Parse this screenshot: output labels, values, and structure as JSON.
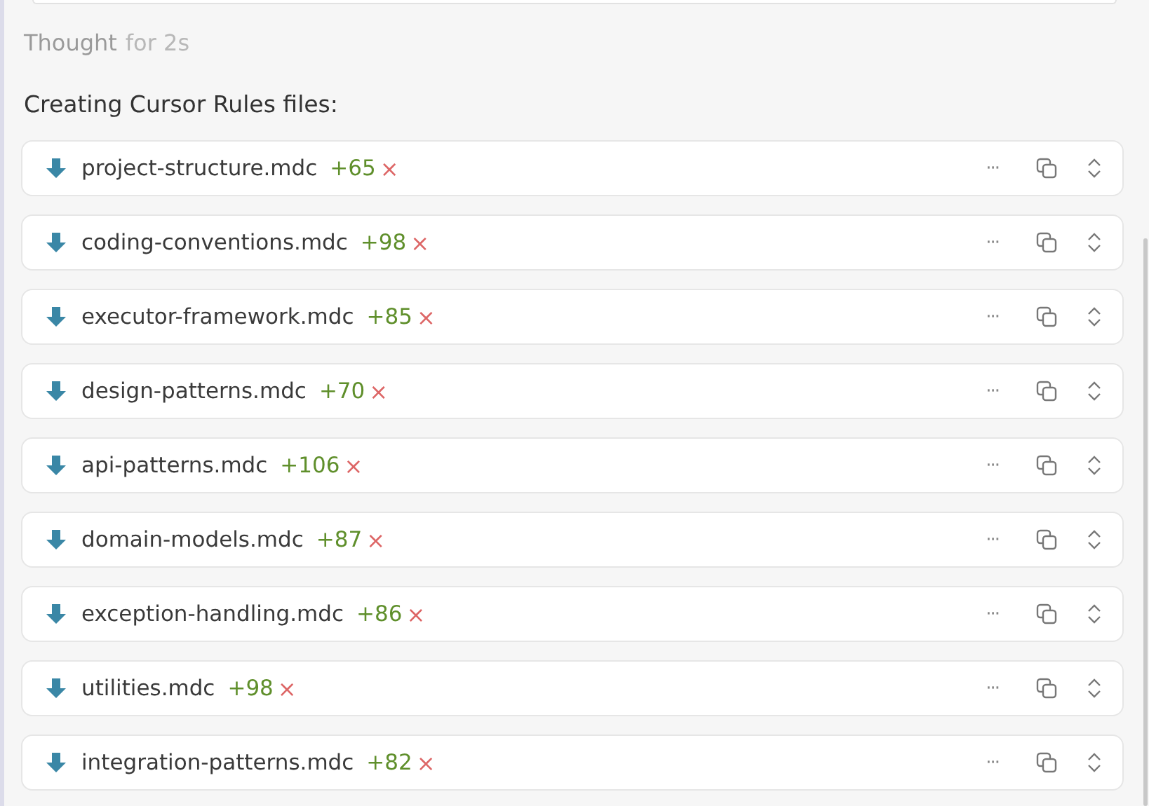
{
  "thought": {
    "label": "Thought",
    "duration": "for 2s"
  },
  "heading": "Creating Cursor Rules files:",
  "files": [
    {
      "name": "project-structure.mdc",
      "added": "+65",
      "reject": "×"
    },
    {
      "name": "coding-conventions.mdc",
      "added": "+98",
      "reject": "×"
    },
    {
      "name": "executor-framework.mdc",
      "added": "+85",
      "reject": "×"
    },
    {
      "name": "design-patterns.mdc",
      "added": "+70",
      "reject": "×"
    },
    {
      "name": "api-patterns.mdc",
      "added": "+106",
      "reject": "×"
    },
    {
      "name": "domain-models.mdc",
      "added": "+87",
      "reject": "×"
    },
    {
      "name": "exception-handling.mdc",
      "added": "+86",
      "reject": "×"
    },
    {
      "name": "utilities.mdc",
      "added": "+98",
      "reject": "×"
    },
    {
      "name": "integration-patterns.mdc",
      "added": "+82",
      "reject": "×"
    }
  ],
  "more_label": "···"
}
